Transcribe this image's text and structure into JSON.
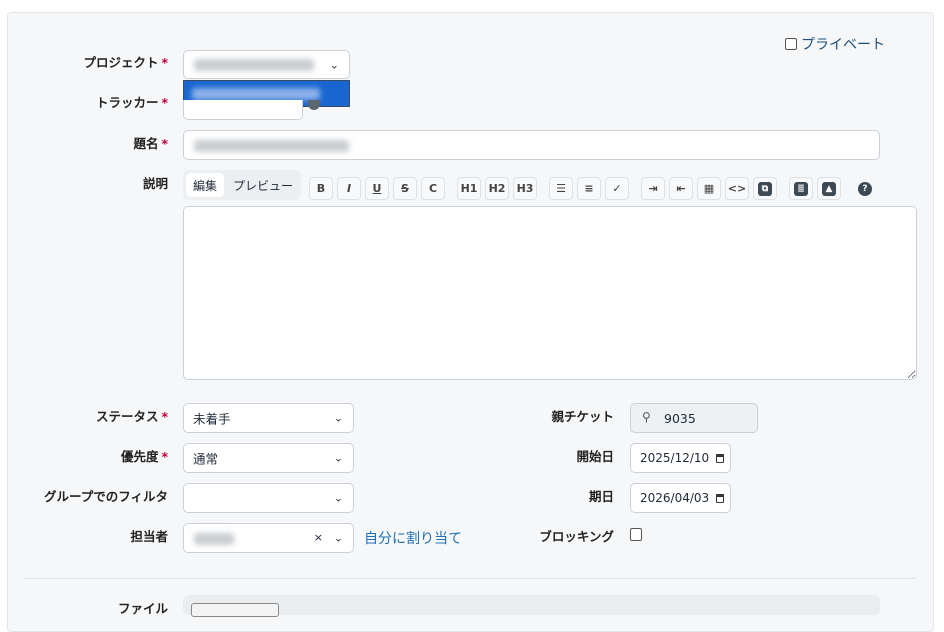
{
  "private_label": "プライベート",
  "labels": {
    "project": "プロジェクト",
    "tracker": "トラッカー",
    "subject": "題名",
    "description": "説明",
    "status": "ステータス",
    "priority": "優先度",
    "group_filter": "グループでのフィルタ",
    "assignee": "担当者",
    "parent": "親チケット",
    "start_date": "開始日",
    "due_date": "期日",
    "blocking": "ブロッキング",
    "files": "ファイル",
    "required": "*"
  },
  "editor_tabs": {
    "edit": "編集",
    "preview": "プレビュー"
  },
  "toolbar": [
    {
      "name": "bold",
      "t": "B"
    },
    {
      "name": "italic",
      "t": "I"
    },
    {
      "name": "underline",
      "t": "U"
    },
    {
      "name": "strikethrough",
      "t": "S"
    },
    {
      "name": "code",
      "t": "C"
    },
    {
      "name": "h1",
      "t": "H1"
    },
    {
      "name": "h2",
      "t": "H2"
    },
    {
      "name": "h3",
      "t": "H3"
    },
    {
      "name": "bullet-list",
      "t": "☰"
    },
    {
      "name": "numbered-list",
      "t": "≡"
    },
    {
      "name": "task-list",
      "t": "✓"
    },
    {
      "name": "indent-right",
      "t": "⇥"
    },
    {
      "name": "indent-left",
      "t": "⇤"
    },
    {
      "name": "table",
      "t": "▦"
    },
    {
      "name": "code-block",
      "t": "<>"
    },
    {
      "name": "collapsed-block",
      "t": "⧉"
    },
    {
      "name": "wiki-link",
      "t": "≣"
    },
    {
      "name": "image",
      "t": "▲"
    },
    {
      "name": "help",
      "t": "?"
    }
  ],
  "status": {
    "value": "未着手"
  },
  "priority": {
    "value": "通常"
  },
  "parent": {
    "value": "9035"
  },
  "start_date": {
    "value": "2025/12/10"
  },
  "due_date": {
    "value": "2026/04/03"
  },
  "assign_to_me": "自分に割り当て",
  "colors": {
    "accent": "#1a66d1",
    "link": "#1f6fb2"
  }
}
